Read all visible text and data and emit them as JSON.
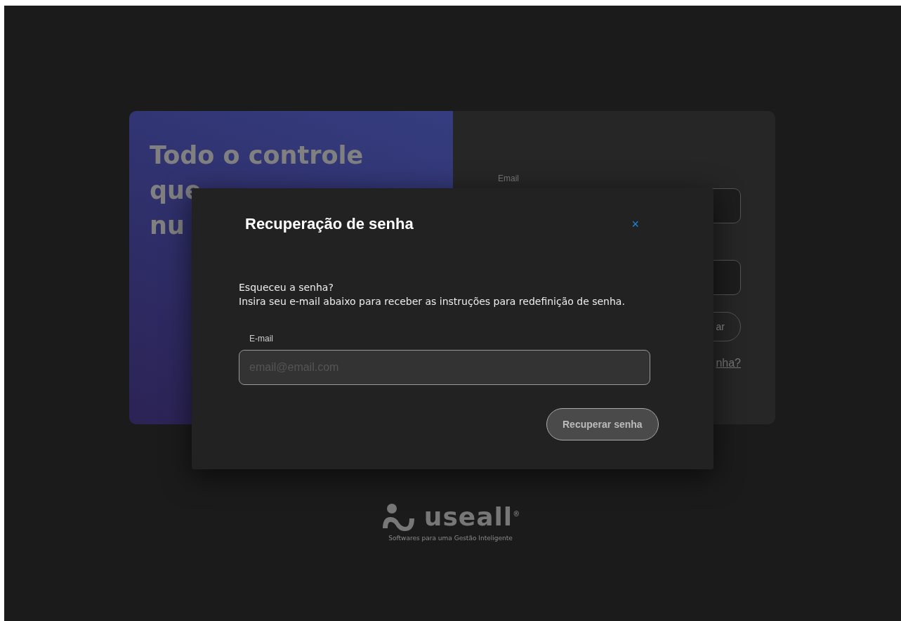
{
  "hero": {
    "heading_lines": [
      "Todo o controle",
      "que",
      "nu"
    ]
  },
  "login_form": {
    "email_label": "Email",
    "button_text": "ar",
    "forgot_link": "nha?"
  },
  "modal": {
    "title": "Recuperação de senha",
    "close": "×",
    "lines": [
      "Esqueceu a senha?",
      "Insira seu e-mail abaixo para receber as instruções para redefinição de senha."
    ],
    "field_label": "E-mail",
    "placeholder": "email@email.com",
    "button": "Recuperar senha"
  },
  "logo": {
    "name": "useall",
    "mark": "®",
    "tagline": "Softwares para uma Gestão Inteligente"
  }
}
